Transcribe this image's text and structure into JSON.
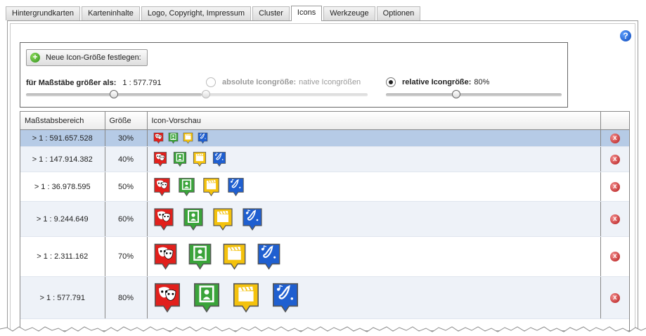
{
  "tabs": [
    {
      "label": "Hintergrundkarten"
    },
    {
      "label": "Karteninhalte"
    },
    {
      "label": "Logo, Copyright, Impressum"
    },
    {
      "label": "Cluster"
    },
    {
      "label": "Icons",
      "active": true
    },
    {
      "label": "Werkzeuge"
    },
    {
      "label": "Optionen"
    }
  ],
  "help": {
    "label": "?"
  },
  "settings": {
    "add_button": "Neue Icon-Größe festlegen:",
    "scale_label_bold": "für Maßstäbe größer als:",
    "scale_value": "1 : 577.791",
    "scale_slider_fraction": 0.5,
    "absolute": {
      "label": "absolute Icongröße:",
      "value": "native Icongrößen",
      "checked": false,
      "disabled": true
    },
    "relative": {
      "label": "relative Icongröße:",
      "value": "80%",
      "checked": true
    },
    "relative_slider_fraction": 0.4
  },
  "table": {
    "headers": {
      "scale": "Maßstabsbereich",
      "size": "Größe",
      "preview": "Icon-Vorschau",
      "delete": ""
    },
    "rows": [
      {
        "scale": "> 1 : 591.657.528",
        "size": "30%",
        "selected": true
      },
      {
        "scale": "> 1 : 147.914.382",
        "size": "40%"
      },
      {
        "scale": "> 1 : 36.978.595",
        "size": "50%"
      },
      {
        "scale": "> 1 : 9.244.649",
        "size": "60%"
      },
      {
        "scale": "> 1 : 2.311.162",
        "size": "70%"
      },
      {
        "scale": "> 1 : 577.791",
        "size": "80%"
      }
    ],
    "preview_icons": [
      {
        "name": "theater-masks-icon",
        "color": "#e2201c"
      },
      {
        "name": "portrait-frame-icon",
        "color": "#3aa43a"
      },
      {
        "name": "film-clapper-icon",
        "color": "#f4c20d"
      },
      {
        "name": "saxophone-music-icon",
        "color": "#1f5fd0"
      }
    ],
    "delete_glyph": "x"
  }
}
